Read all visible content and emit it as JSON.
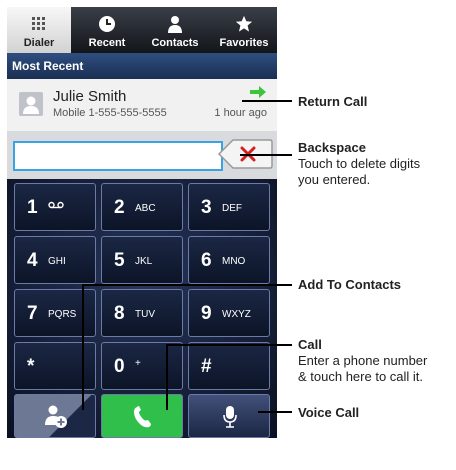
{
  "tabs": [
    {
      "label": "Dialer",
      "icon": "dialpad-icon"
    },
    {
      "label": "Recent",
      "icon": "clock-icon"
    },
    {
      "label": "Contacts",
      "icon": "person-icon"
    },
    {
      "label": "Favorites",
      "icon": "star-icon"
    }
  ],
  "most_recent": {
    "header": "Most Recent",
    "name": "Julie Smith",
    "number": "Mobile 1-555-555-5555",
    "time": "1 hour ago"
  },
  "digits_field": {
    "value": ""
  },
  "keys": [
    {
      "digit": "1",
      "letters": "voicemail-icon"
    },
    {
      "digit": "2",
      "letters": "ABC"
    },
    {
      "digit": "3",
      "letters": "DEF"
    },
    {
      "digit": "4",
      "letters": "GHI"
    },
    {
      "digit": "5",
      "letters": "JKL"
    },
    {
      "digit": "6",
      "letters": "MNO"
    },
    {
      "digit": "7",
      "letters": "PQRS"
    },
    {
      "digit": "8",
      "letters": "TUV"
    },
    {
      "digit": "9",
      "letters": "WXYZ"
    },
    {
      "digit": "*",
      "letters": ""
    },
    {
      "digit": "0",
      "letters": "+"
    },
    {
      "digit": "#",
      "letters": ""
    }
  ],
  "callouts": {
    "return_call": "Return Call",
    "backspace_title": "Backspace",
    "backspace_desc1": "Touch to delete digits",
    "backspace_desc2": "you entered.",
    "add_contacts": "Add To Contacts",
    "call_title": "Call",
    "call_desc1": "Enter a phone number",
    "call_desc2": "& touch here to call it.",
    "voice_call": "Voice Call"
  },
  "colors": {
    "arrow_green": "#3cc43c",
    "call_green": "#2fbf4a",
    "backspace_red": "#d62020",
    "focus_blue": "#3aa3e3"
  }
}
